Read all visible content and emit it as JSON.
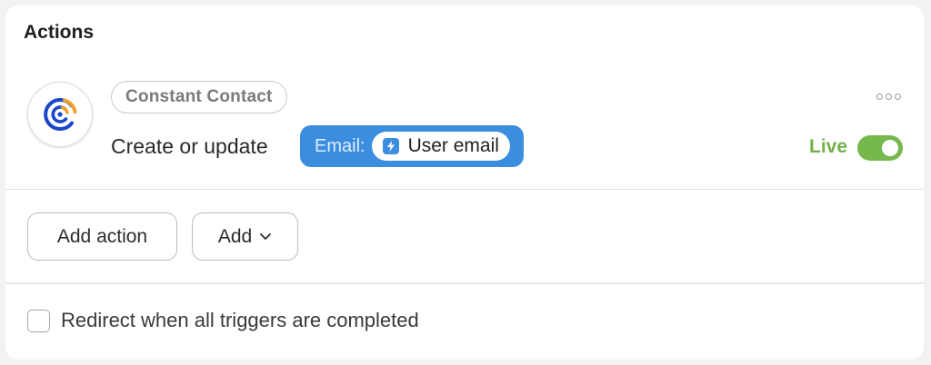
{
  "section": {
    "title": "Actions"
  },
  "action": {
    "app_icon": "constant-contact-logo-icon",
    "app_name": "Constant Contact",
    "description": "Create or update",
    "field_label": "Email:",
    "field_value_icon": "bolt-icon",
    "field_value": "User email",
    "menu_icon": "more-horizontal-icon",
    "status_label": "Live",
    "status_on": true
  },
  "buttons": {
    "add_action": "Add action",
    "add": "Add",
    "add_icon": "chevron-down-icon"
  },
  "redirect": {
    "label": "Redirect when all triggers are completed",
    "checked": false
  },
  "colors": {
    "accent_blue": "#3b8de0",
    "live_green": "#72b04a",
    "logo_blue": "#1c46c9",
    "logo_orange": "#f2a02a"
  }
}
